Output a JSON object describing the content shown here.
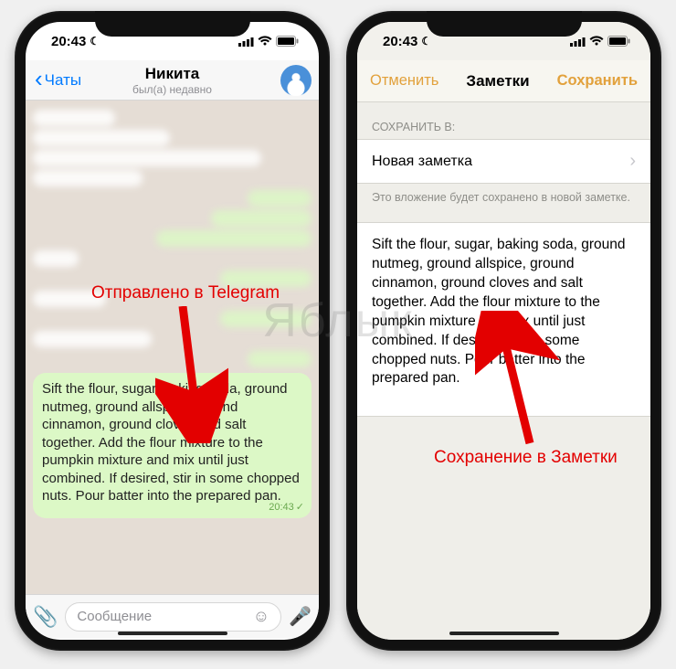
{
  "watermark": "Яблык",
  "status": {
    "time": "20:43",
    "moon_icon": "☾"
  },
  "left": {
    "back_label": "Чаты",
    "title": "Никита",
    "subtitle": "был(а) недавно",
    "annotation": "Отправлено в Telegram",
    "recipe": "Sift the flour, sugar, baking soda, ground nutmeg, ground allspice, ground cinnamon, ground cloves and salt together. Add the flour mixture to the pumpkin mixture and mix until just combined. If desired, stir in some chopped nuts. Pour batter into the prepared pan.",
    "msg_time": "20:43",
    "input_placeholder": "Сообщение"
  },
  "right": {
    "cancel": "Отменить",
    "title": "Заметки",
    "save": "Сохранить",
    "section_label": "СОХРАНИТЬ В:",
    "target": "Новая заметка",
    "hint": "Это вложение будет сохранено в новой заметке.",
    "annotation": "Сохранение в Заметки",
    "content": "Sift the flour, sugar, baking soda, ground nutmeg, ground allspice, ground cinnamon, ground cloves and salt together. Add the flour mixture to the pumpkin mixture and mix until just combined. If desired, stir in some chopped nuts. Pour batter into the prepared pan."
  }
}
